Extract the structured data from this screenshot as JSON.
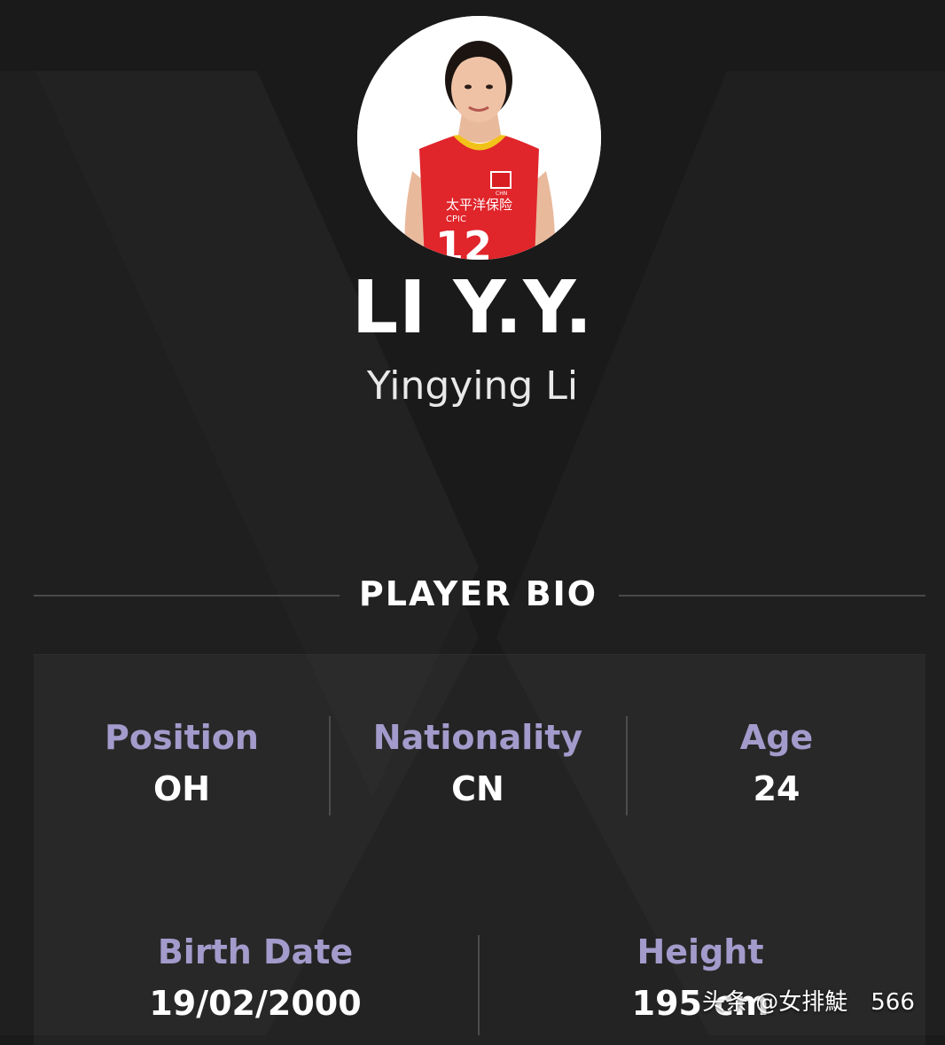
{
  "player": {
    "short_name": "LI Y.Y.",
    "full_name": "Yingying Li",
    "jersey": {
      "sponsor_cn": "太平洋保险",
      "sponsor_en": "CPIC",
      "number": "12",
      "team_badge": "CHN"
    }
  },
  "bio": {
    "title": "PLAYER BIO",
    "stats": [
      {
        "label": "Position",
        "value": "OH"
      },
      {
        "label": "Nationality",
        "value": "CN"
      },
      {
        "label": "Age",
        "value": "24"
      },
      {
        "label": "Birth Date",
        "value": "19/02/2000"
      },
      {
        "label": "Height",
        "value": "195 cm"
      }
    ]
  },
  "watermark": {
    "text": "头条 @女排鯐",
    "count": "566"
  },
  "colors": {
    "background": "#1a1a1a",
    "label_accent": "#a29bcb",
    "jersey_red": "#e0252b",
    "text": "#ffffff"
  }
}
